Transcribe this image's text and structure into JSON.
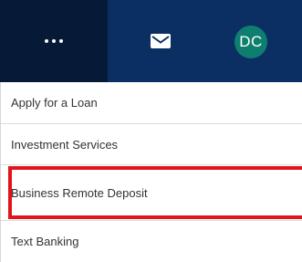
{
  "header": {
    "more_icon": "more-dots-icon",
    "mail_icon": "mail-icon",
    "avatar_initials": "DC",
    "colors": {
      "bar": "#0b2f63",
      "more_active": "#061a38",
      "avatar": "#0e7f6f"
    }
  },
  "menu": {
    "items": [
      {
        "label": "Apply for a Loan"
      },
      {
        "label": "Investment Services"
      },
      {
        "label": "Business Remote Deposit",
        "highlighted": true
      },
      {
        "label": "Text Banking"
      }
    ],
    "highlight_color": "#e0151b"
  }
}
